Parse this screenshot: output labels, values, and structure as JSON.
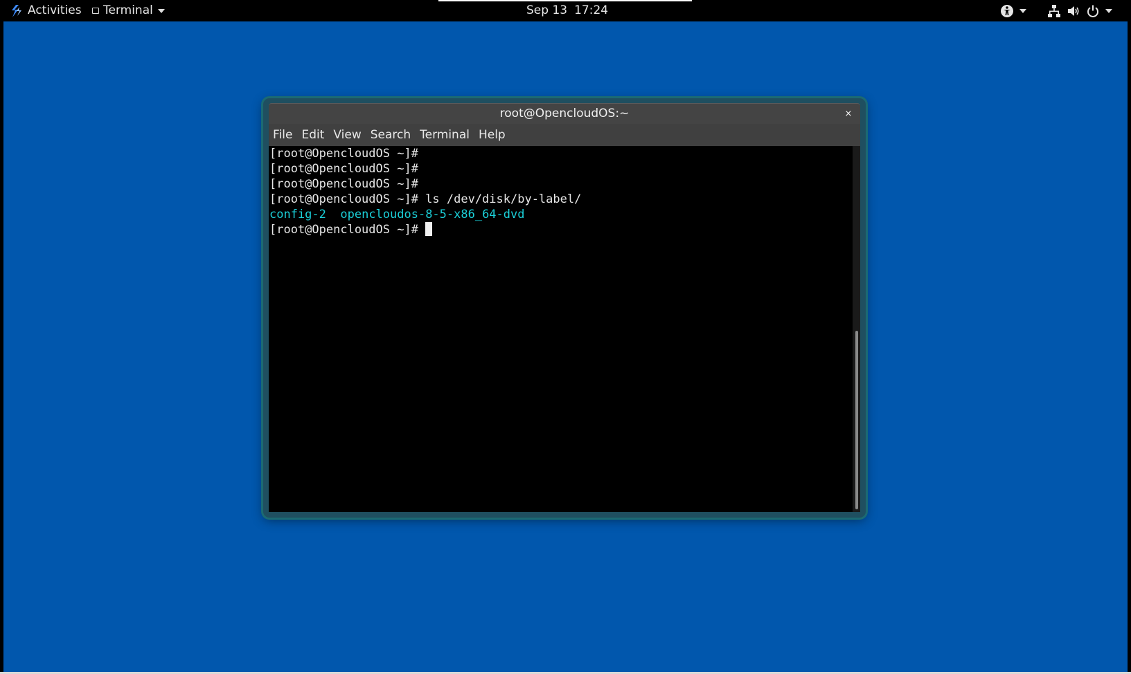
{
  "topbar": {
    "activities_label": "Activities",
    "app_menu_label": "Terminal",
    "clock_date": "Sep 13",
    "clock_time": "17:24",
    "icons": [
      "opencloudos-logo-icon",
      "window-icon",
      "accessibility-icon",
      "network-icon",
      "volume-icon",
      "power-icon"
    ]
  },
  "desktop": {
    "background_color": "#0157ad"
  },
  "terminal": {
    "title": "root@OpencloudOS:~",
    "close_label": "×",
    "menu": [
      "File",
      "Edit",
      "View",
      "Search",
      "Terminal",
      "Help"
    ],
    "lines": [
      {
        "prompt": "[root@OpencloudOS ~]#",
        "command": ""
      },
      {
        "prompt": "[root@OpencloudOS ~]#",
        "command": ""
      },
      {
        "prompt": "[root@OpencloudOS ~]#",
        "command": ""
      },
      {
        "prompt": "[root@OpencloudOS ~]#",
        "command": " ls /dev/disk/by-label/"
      }
    ],
    "output": [
      "config-2",
      "opencloudos-8-5-x86_64-dvd"
    ],
    "final_prompt": "[root@OpencloudOS ~]# ",
    "colors": {
      "output_text": "#1bd0d9",
      "text": "#e6e6e6",
      "background": "#000000"
    }
  }
}
